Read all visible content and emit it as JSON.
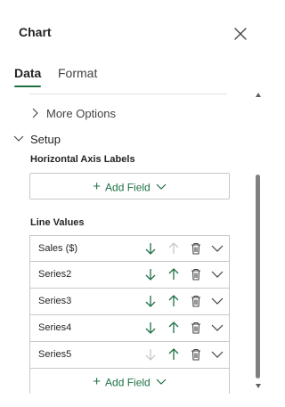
{
  "pane": {
    "title": "Chart"
  },
  "tabs": [
    {
      "label": "Data",
      "selected": true
    },
    {
      "label": "Format",
      "selected": false
    }
  ],
  "more_options": {
    "label": "More Options",
    "expanded": false
  },
  "setup": {
    "label": "Setup",
    "expanded": true
  },
  "horizontal_axis": {
    "label": "Horizontal Axis Labels",
    "add_field_label": "Add Field"
  },
  "line_values": {
    "label": "Line Values",
    "series": [
      {
        "name": "Sales ($)",
        "move_down_enabled": true,
        "move_up_enabled": false
      },
      {
        "name": "Series2",
        "move_down_enabled": true,
        "move_up_enabled": true
      },
      {
        "name": "Series3",
        "move_down_enabled": true,
        "move_up_enabled": true
      },
      {
        "name": "Series4",
        "move_down_enabled": true,
        "move_up_enabled": true
      },
      {
        "name": "Series5",
        "move_down_enabled": false,
        "move_up_enabled": true
      }
    ],
    "add_field_label": "Add Field"
  },
  "colors": {
    "accent": "#1e7145",
    "enabled_arrow": "#1e7145",
    "disabled_arrow": "#c8c8c8",
    "icon_gray": "#424242",
    "border": "#c8c8c8"
  },
  "icons": {
    "close": "close-icon",
    "more_options_chevron": "chevron-right-icon",
    "setup_chevron": "chevron-down-icon",
    "add": "plus-icon",
    "dropdown": "chevron-down-icon",
    "move_down": "arrow-down-icon",
    "move_up": "arrow-up-icon",
    "delete": "trash-icon",
    "row_menu": "chevron-down-icon"
  }
}
